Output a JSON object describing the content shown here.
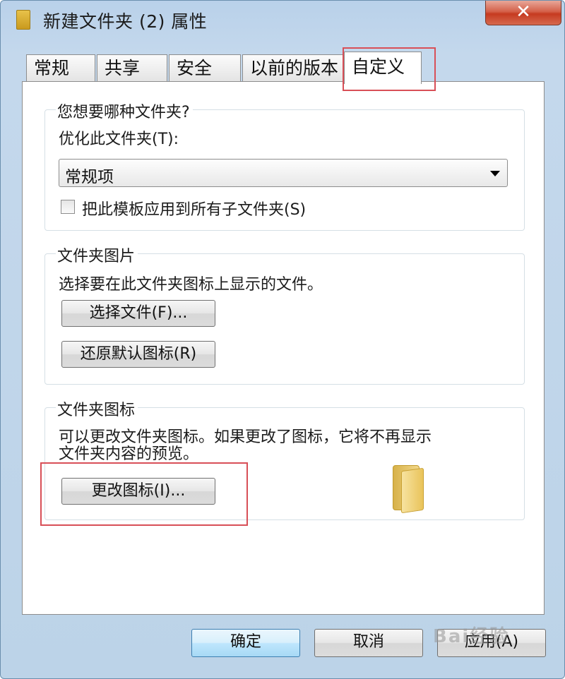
{
  "window": {
    "title": "新建文件夹 (2) 属性",
    "close_label": "✕"
  },
  "tabs": [
    {
      "label": "常规"
    },
    {
      "label": "共享"
    },
    {
      "label": "安全"
    },
    {
      "label": "以前的版本"
    },
    {
      "label": "自定义",
      "active": true
    }
  ],
  "folder_type": {
    "group_title": "您想要哪种文件夹?",
    "optimize_label": "优化此文件夹(T):",
    "selected_value": "常规项",
    "apply_subfolders_label": "把此模板应用到所有子文件夹(S)",
    "apply_subfolders_checked": false
  },
  "folder_pictures": {
    "group_title": "文件夹图片",
    "description": "选择要在此文件夹图标上显示的文件。",
    "choose_file_button": "选择文件(F)...",
    "restore_default_button": "还原默认图标(R)"
  },
  "folder_icons": {
    "group_title": "文件夹图标",
    "description_line1": "可以更改文件夹图标。如果更改了图标，它将不再显示",
    "description_line2": "文件夹内容的预览。",
    "change_icon_button": "更改图标(I)...",
    "preview_icon": "folder-icon"
  },
  "footer": {
    "ok_button": "确定",
    "cancel_button": "取消",
    "apply_button": "应用(A)"
  },
  "watermark": "Bai经验",
  "colors": {
    "highlight": "#d84f57",
    "close_red": "#c63a20",
    "primary_button_border": "#3c7fb1"
  }
}
